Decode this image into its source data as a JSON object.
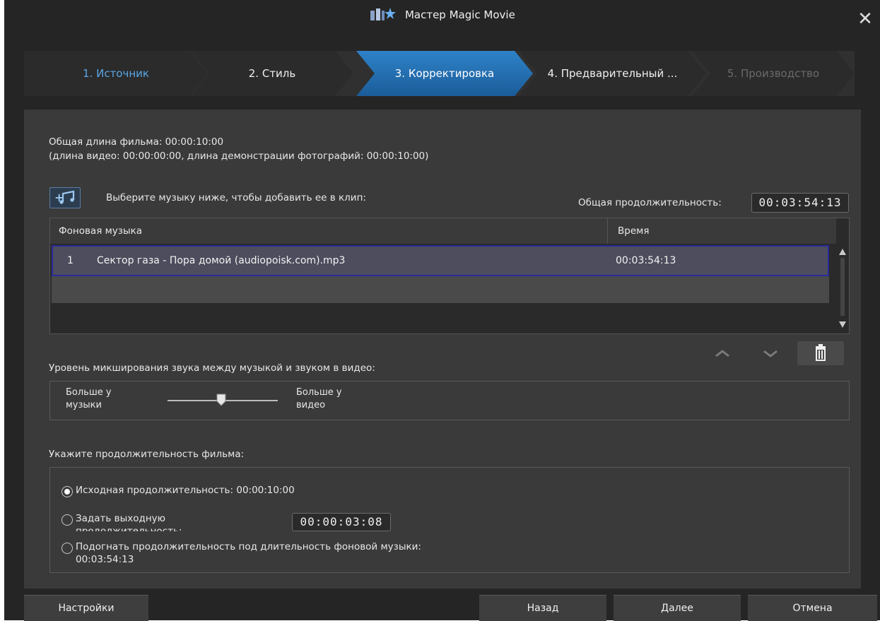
{
  "window": {
    "title": "Мастер Magic Movie",
    "close_symbol": "✕"
  },
  "steps": [
    {
      "label": "1. Источник",
      "state": "done"
    },
    {
      "label": "2. Стиль",
      "state": "normal"
    },
    {
      "label": "3. Корректировка",
      "state": "active"
    },
    {
      "label": "4. Предварительный ...",
      "state": "normal"
    },
    {
      "label": "5. Производство",
      "state": "disabled"
    }
  ],
  "info": {
    "total_length": "Общая длина фильма: 00:00:10:00",
    "details": "(длина видео: 00:00:00:00, длина демонстрации фотографий: 00:00:10:00)"
  },
  "music": {
    "add_button_icon": "add-music-icon",
    "prompt": "Выберите музыку ниже, чтобы добавить ее в клип:",
    "total_duration_label": "Общая продолжительность:",
    "total_duration_value": "00:03:54:13",
    "columns": {
      "background_music": "Фоновая музыка",
      "time": "Время"
    },
    "rows": [
      {
        "index": "1",
        "name": "Сектор газа - Пора домой (audiopoisk.com).mp3",
        "time": "00:03:54:13"
      }
    ],
    "controls": {
      "up_icon": "chevron-up-icon",
      "down_icon": "chevron-down-icon",
      "delete_icon": "trash-icon"
    }
  },
  "mix": {
    "label": "Уровень микширования звука между музыкой и звуком в видео:",
    "left_label_line1": "Больше у",
    "left_label_line2": "музыки",
    "right_label_line1": "Больше у",
    "right_label_line2": "видео"
  },
  "duration": {
    "label": "Укажите продолжительность фильма:",
    "options": [
      {
        "label": "Исходная продолжительность: 00:00:10:00",
        "selected": true
      },
      {
        "label_line1": "Задать выходную",
        "label_line2": "продолжительность:",
        "selected": false,
        "value": "00:00:03:08"
      },
      {
        "label_line1": "Подогнать продолжительность под длительность фоновой музыки:",
        "label_line2": "00:03:54:13",
        "selected": false
      }
    ]
  },
  "footer": {
    "settings": "Настройки",
    "back": "Назад",
    "next": "Далее",
    "cancel": "Отмена"
  },
  "colors": {
    "accent": "#2e82c8",
    "selected_row_border": "#2a2a9a",
    "background": "#252525"
  }
}
